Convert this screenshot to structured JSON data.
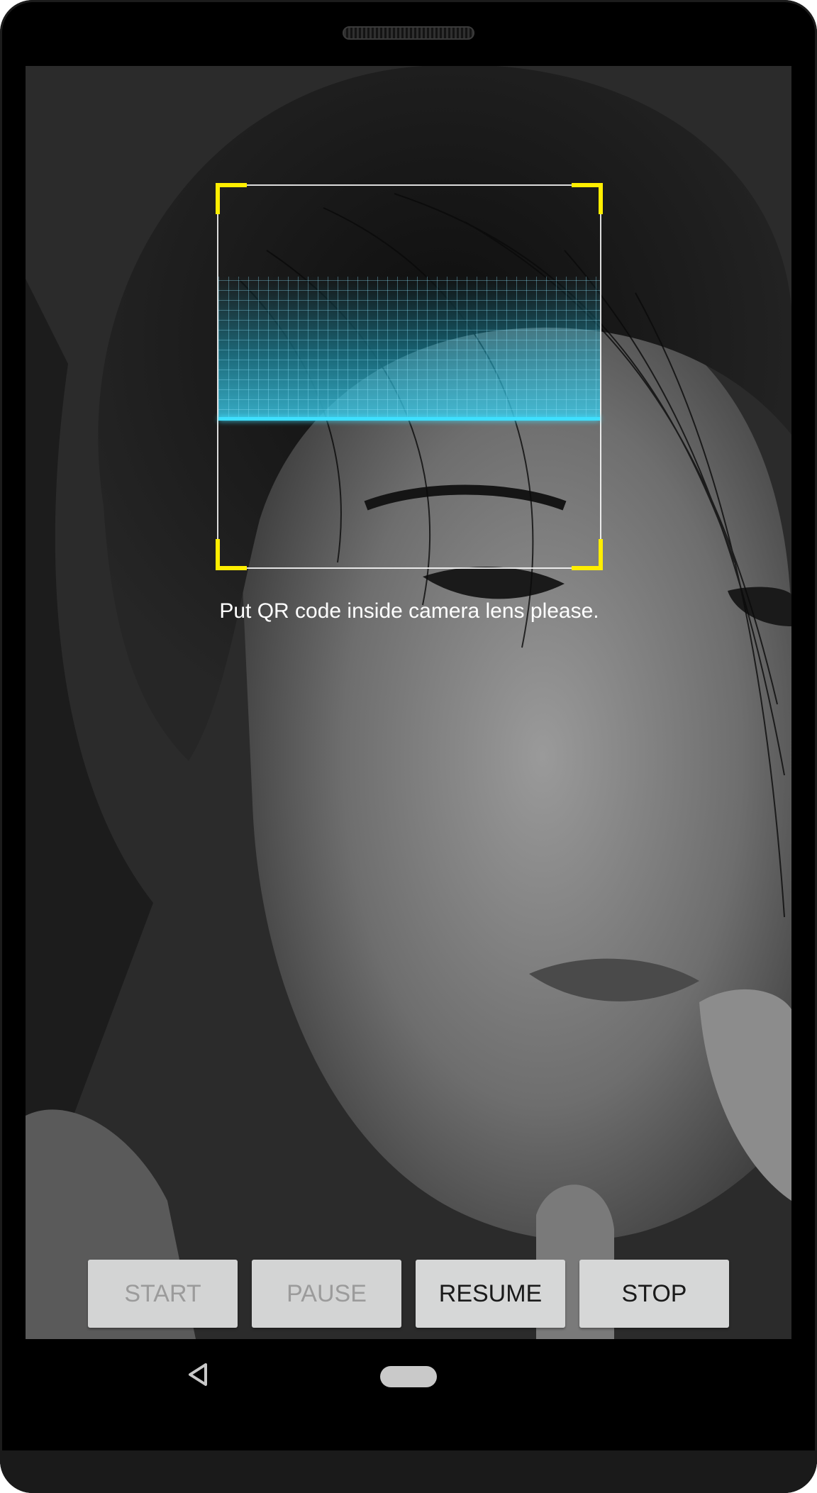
{
  "scanner": {
    "hint_text": "Put QR code inside camera lens please.",
    "corner_color": "#ffee00",
    "scan_line_color": "#3fe0ff"
  },
  "controls": {
    "start_label": "START",
    "pause_label": "PAUSE",
    "resume_label": "RESUME",
    "stop_label": "STOP",
    "disabled": [
      "START",
      "PAUSE"
    ]
  },
  "navigation": {
    "back_icon": "back-triangle-icon",
    "home_icon": "home-pill-icon"
  }
}
